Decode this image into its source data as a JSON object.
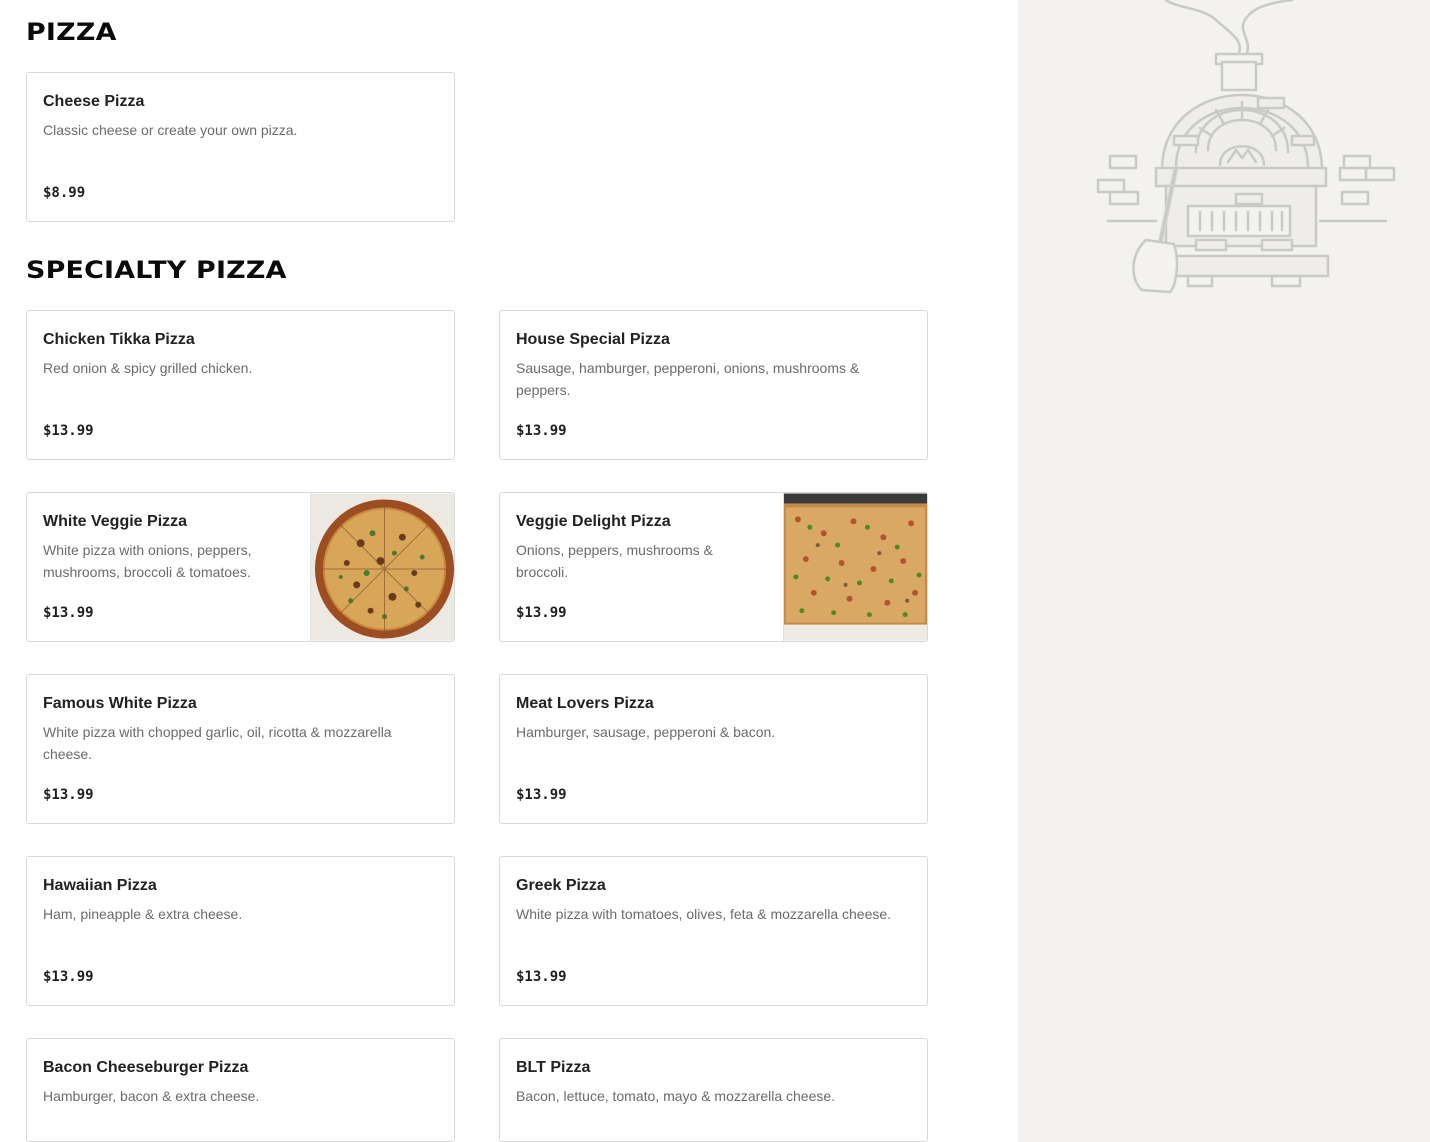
{
  "sections": [
    {
      "title": "PIZZA",
      "items": [
        {
          "name": "Cheese Pizza",
          "description": "Classic cheese or create your own pizza.",
          "price": "$8.99"
        }
      ]
    },
    {
      "title": "SPECIALTY PIZZA",
      "items": [
        {
          "name": "Chicken Tikka Pizza",
          "description": "Red onion & spicy grilled chicken.",
          "price": "$13.99"
        },
        {
          "name": "House Special Pizza",
          "description": "Sausage, hamburger, pepperoni, onions, mushrooms & peppers.",
          "price": "$13.99"
        },
        {
          "name": "White Veggie Pizza",
          "description": "White pizza with onions, peppers, mushrooms, broccoli & tomatoes.",
          "price": "$13.99",
          "photo": "round-pizza-photo"
        },
        {
          "name": "Veggie Delight Pizza",
          "description": "Onions, peppers, mushrooms & broccoli.",
          "price": "$13.99",
          "photo": "square-pizza-photo"
        },
        {
          "name": "Famous White Pizza",
          "description": "White pizza with chopped garlic, oil, ricotta & mozzarella cheese.",
          "price": "$13.99"
        },
        {
          "name": "Meat Lovers Pizza",
          "description": "Hamburger, sausage, pepperoni & bacon.",
          "price": "$13.99"
        },
        {
          "name": "Hawaiian Pizza",
          "description": "Ham, pineapple & extra cheese.",
          "price": "$13.99"
        },
        {
          "name": "Greek Pizza",
          "description": "White pizza with tomatoes, olives, feta & mozzarella cheese.",
          "price": "$13.99"
        },
        {
          "name": "Bacon Cheeseburger Pizza",
          "description": "Hamburger, bacon & extra cheese.",
          "price": ""
        },
        {
          "name": "BLT Pizza",
          "description": "Bacon, lettuce, tomato, mayo & mozzarella cheese.",
          "price": ""
        }
      ]
    }
  ],
  "sidebar": {
    "illustration": "pizza-oven-illustration"
  },
  "colors": {
    "sidebar_bg": "#f3f2ee",
    "card_border": "#d9d9d9",
    "desc_text": "#6b6b6b"
  }
}
